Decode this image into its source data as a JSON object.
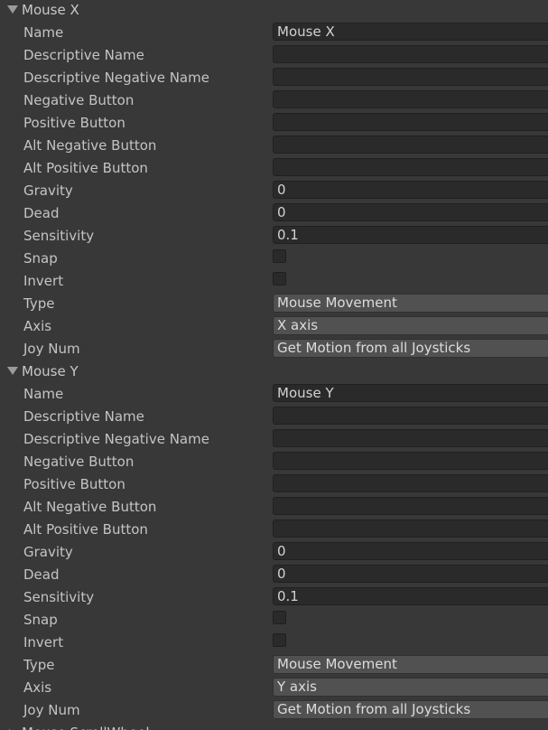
{
  "axes": [
    {
      "name": "Mouse X",
      "expanded": true,
      "labels": {
        "name": "Name",
        "descriptive_name": "Descriptive Name",
        "descriptive_negative_name": "Descriptive Negative Name",
        "negative_button": "Negative Button",
        "positive_button": "Positive Button",
        "alt_negative_button": "Alt Negative Button",
        "alt_positive_button": "Alt Positive Button",
        "gravity": "Gravity",
        "dead": "Dead",
        "sensitivity": "Sensitivity",
        "snap": "Snap",
        "invert": "Invert",
        "type": "Type",
        "axis": "Axis",
        "joy_num": "Joy Num"
      },
      "values": {
        "name": "Mouse X",
        "descriptive_name": "",
        "descriptive_negative_name": "",
        "negative_button": "",
        "positive_button": "",
        "alt_negative_button": "",
        "alt_positive_button": "",
        "gravity": "0",
        "dead": "0",
        "sensitivity": "0.1",
        "snap": false,
        "invert": false,
        "type": "Mouse Movement",
        "axis": "X axis",
        "joy_num": "Get Motion from all Joysticks"
      }
    },
    {
      "name": "Mouse Y",
      "expanded": true,
      "labels": {
        "name": "Name",
        "descriptive_name": "Descriptive Name",
        "descriptive_negative_name": "Descriptive Negative Name",
        "negative_button": "Negative Button",
        "positive_button": "Positive Button",
        "alt_negative_button": "Alt Negative Button",
        "alt_positive_button": "Alt Positive Button",
        "gravity": "Gravity",
        "dead": "Dead",
        "sensitivity": "Sensitivity",
        "snap": "Snap",
        "invert": "Invert",
        "type": "Type",
        "axis": "Axis",
        "joy_num": "Joy Num"
      },
      "values": {
        "name": "Mouse Y",
        "descriptive_name": "",
        "descriptive_negative_name": "",
        "negative_button": "",
        "positive_button": "",
        "alt_negative_button": "",
        "alt_positive_button": "",
        "gravity": "0",
        "dead": "0",
        "sensitivity": "0.1",
        "snap": false,
        "invert": false,
        "type": "Mouse Movement",
        "axis": "Y axis",
        "joy_num": "Get Motion from all Joysticks"
      }
    },
    {
      "name": "Mouse ScrollWheel",
      "expanded": false
    }
  ],
  "icons": {
    "expanded": "triangle-down-icon",
    "collapsed": "triangle-right-icon"
  },
  "colors": {
    "background": "#383838",
    "text": "#c4c4c4",
    "field": "#2a2a2a",
    "dropdown": "#515151"
  }
}
